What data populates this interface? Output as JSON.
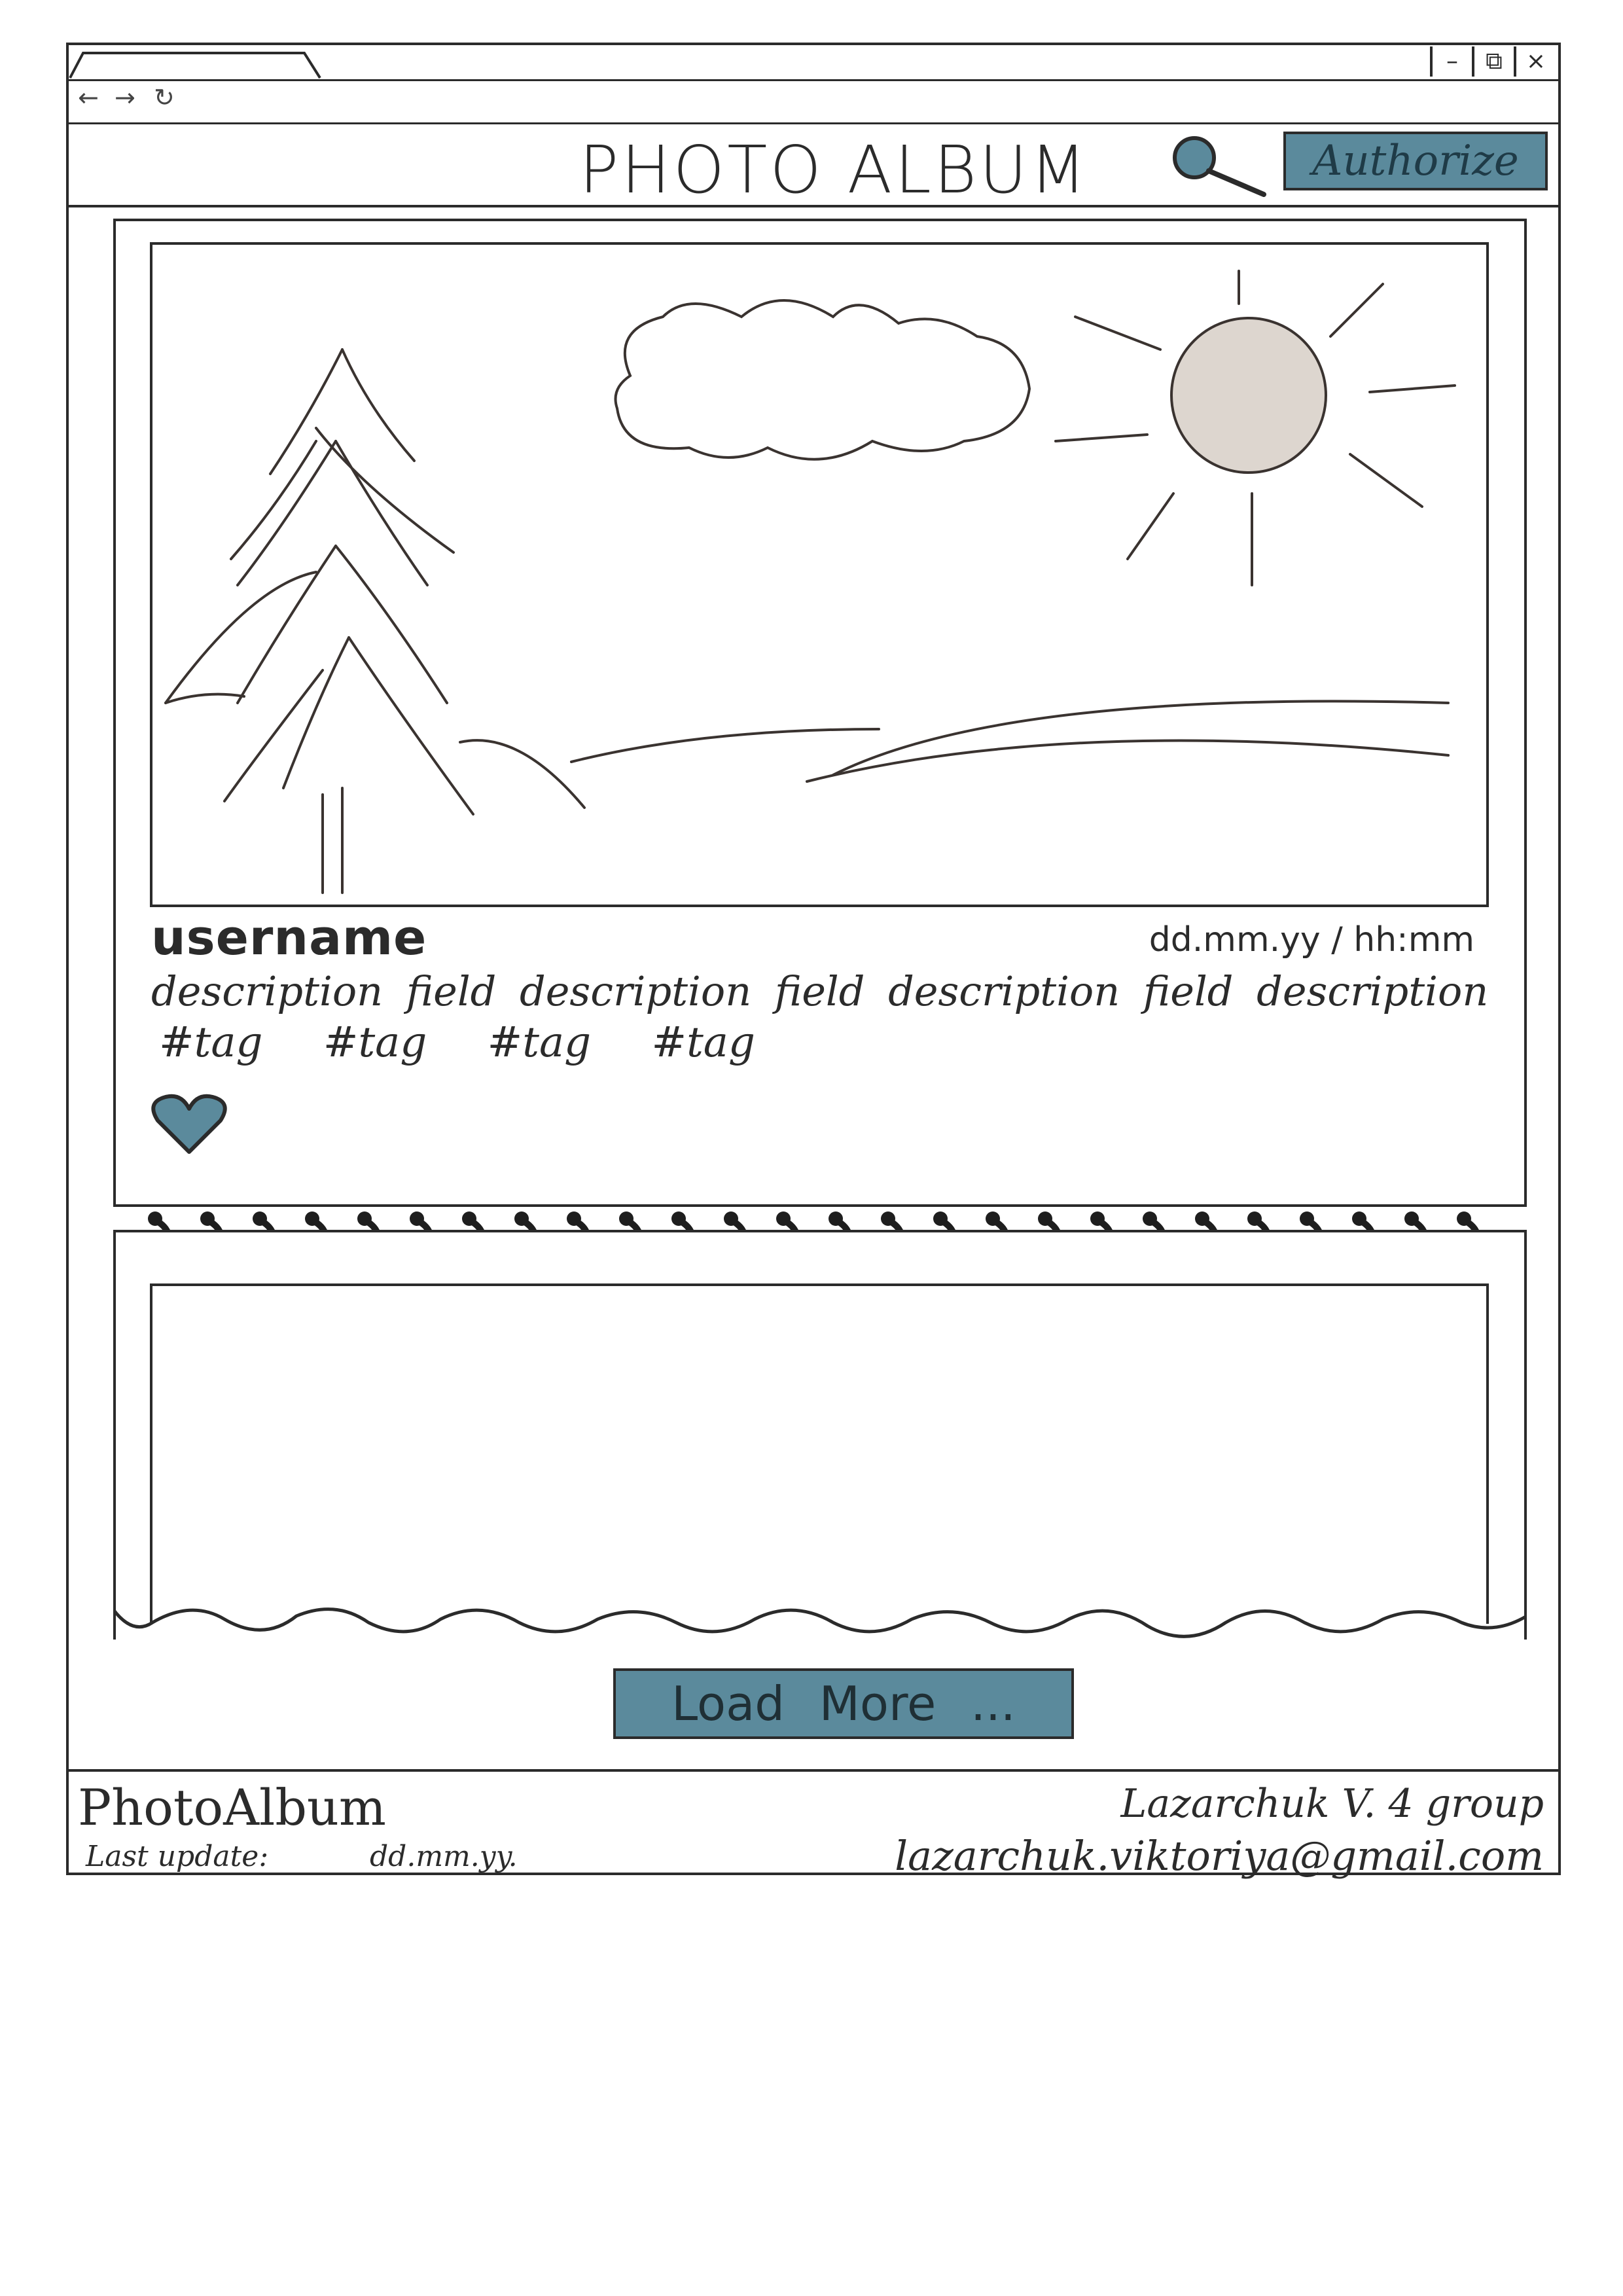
{
  "window": {
    "controls": {
      "minimize": "–",
      "restore": "⧉",
      "close": "×"
    },
    "nav": {
      "back": "←",
      "forward": "→",
      "reload": "↻"
    }
  },
  "header": {
    "title": "PHOTO ALBUM",
    "search_icon": "search-icon",
    "authorize_label": "Authorize"
  },
  "post": {
    "username": "username",
    "datetime": "dd.mm.yy / hh:mm",
    "description": "description field description field description field description",
    "tags": [
      "#tag",
      "#tag",
      "#tag",
      "#tag"
    ],
    "like_icon": "heart-icon"
  },
  "load_more_label": "Load More ...",
  "footer": {
    "brand": "PhotoAlbum",
    "last_update_label": "Last update:",
    "last_update_value": "dd.mm.yy.",
    "author": "Lazarchuk V. 4 group",
    "email": "lazarchuk.viktoriya@gmail.com"
  },
  "colors": {
    "accent": "#5b8a9c",
    "ink": "#2b2b2b"
  }
}
